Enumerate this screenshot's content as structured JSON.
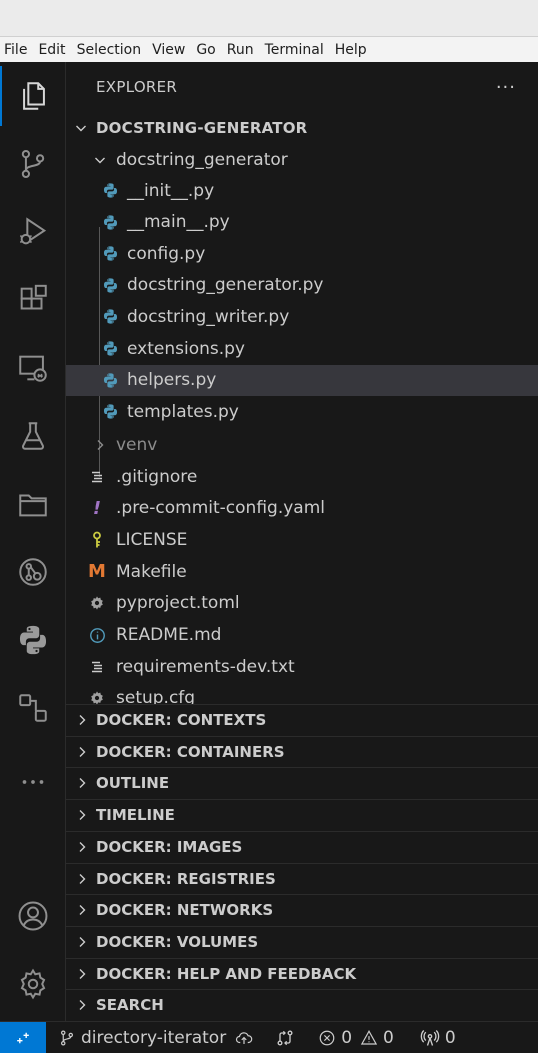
{
  "menubar": [
    "File",
    "Edit",
    "Selection",
    "View",
    "Go",
    "Run",
    "Terminal",
    "Help"
  ],
  "explorer": {
    "title": "EXPLORER",
    "more": "···",
    "root": "DOCSTRING-GENERATOR",
    "folder": "docstring_generator",
    "files": [
      {
        "name": "__init__.py",
        "icon": "python-icon"
      },
      {
        "name": "__main__.py",
        "icon": "python-icon"
      },
      {
        "name": "config.py",
        "icon": "python-icon"
      },
      {
        "name": "docstring_generator.py",
        "icon": "python-icon"
      },
      {
        "name": "docstring_writer.py",
        "icon": "python-icon"
      },
      {
        "name": "extensions.py",
        "icon": "python-icon"
      },
      {
        "name": "helpers.py",
        "icon": "python-icon"
      },
      {
        "name": "templates.py",
        "icon": "python-icon"
      }
    ],
    "venv": "venv",
    "root_files": [
      {
        "name": ".gitignore",
        "icon": "lines-icon"
      },
      {
        "name": ".pre-commit-config.yaml",
        "icon": "exclamation-icon"
      },
      {
        "name": "LICENSE",
        "icon": "key-icon"
      },
      {
        "name": "Makefile",
        "icon": "m-icon"
      },
      {
        "name": "pyproject.toml",
        "icon": "gear-icon"
      },
      {
        "name": "README.md",
        "icon": "info-icon"
      },
      {
        "name": "requirements-dev.txt",
        "icon": "lines-icon"
      },
      {
        "name": "setup.cfg",
        "icon": "gear-icon"
      }
    ],
    "selected_file": "helpers.py"
  },
  "sections": [
    "DOCKER: CONTEXTS",
    "DOCKER: CONTAINERS",
    "OUTLINE",
    "TIMELINE",
    "DOCKER: IMAGES",
    "DOCKER: REGISTRIES",
    "DOCKER: NETWORKS",
    "DOCKER: VOLUMES",
    "DOCKER: HELP AND FEEDBACK",
    "SEARCH"
  ],
  "activity_icons": [
    "files-icon",
    "source-control-icon",
    "run-debug-icon",
    "extensions-icon",
    "remote-explorer-icon",
    "testing-icon",
    "folder-icon",
    "git-graph-icon",
    "python-icon",
    "docker-icon",
    "more-icon",
    "account-icon",
    "settings-gear-icon"
  ],
  "statusbar": {
    "branch": "directory-iterator",
    "errors": "0",
    "warnings": "0",
    "ports": "0"
  },
  "colors": {
    "accent": "#0078d4",
    "python_blue": "#519aba",
    "makefile_orange": "#e37933",
    "yaml_purple": "#a074c4",
    "license_yellow": "#cbcb41"
  }
}
